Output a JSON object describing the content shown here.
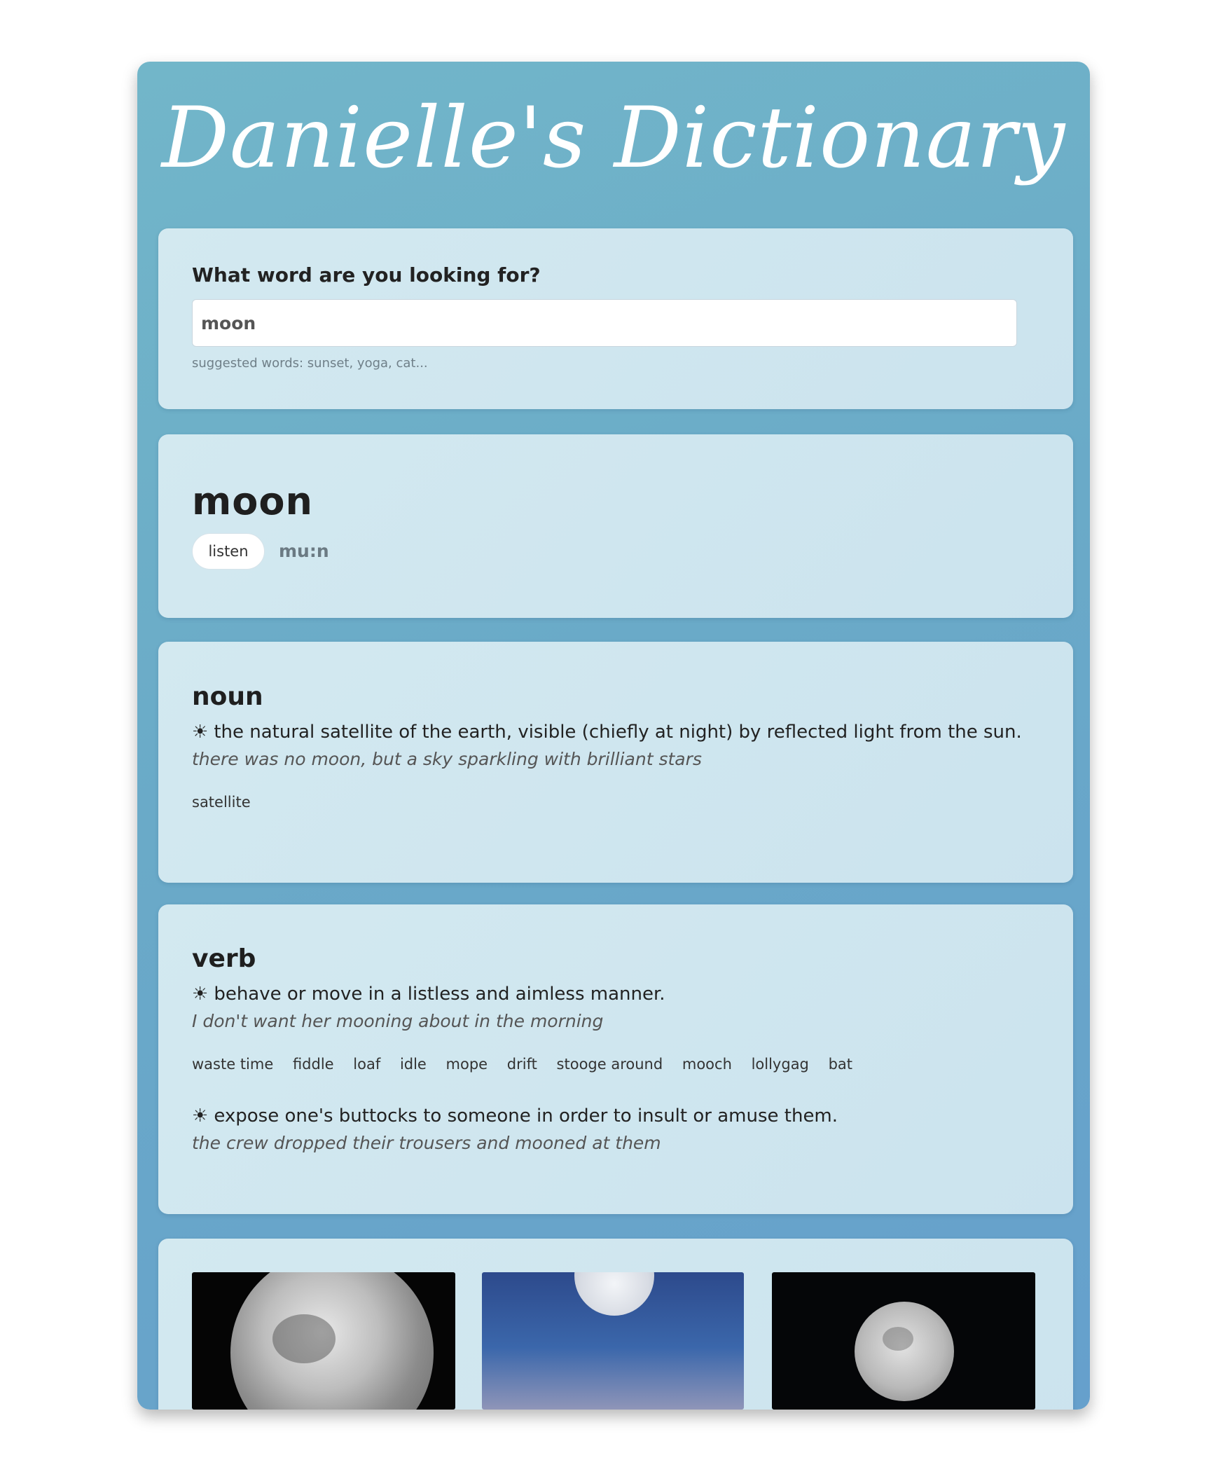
{
  "app": {
    "title": "Danielle's Dictionary"
  },
  "search": {
    "question": "What word are you looking for?",
    "value": "moon",
    "suggested": "suggested words: sunset, yoga, cat..."
  },
  "word": {
    "text": "moon",
    "listen_label": "listen",
    "phonetic": "mu:n"
  },
  "meanings": [
    {
      "part_of_speech": "noun",
      "definitions": [
        {
          "bullet": "☀",
          "definition": "the natural satellite of the earth, visible (chiefly at night) by reflected light from the sun.",
          "example": "there was no moon, but a sky sparkling with brilliant stars",
          "synonyms": [
            "satellite"
          ]
        }
      ]
    },
    {
      "part_of_speech": "verb",
      "definitions": [
        {
          "bullet": "☀",
          "definition": "behave or move in a listless and aimless manner.",
          "example": "I don't want her mooning about in the morning",
          "synonyms": [
            "waste time",
            "fiddle",
            "loaf",
            "idle",
            "mope",
            "drift",
            "stooge around",
            "mooch",
            "lollygag",
            "bat"
          ]
        },
        {
          "bullet": "☀",
          "definition": "expose one's buttocks to someone in order to insult or amuse them.",
          "example": "the crew dropped their trousers and mooned at them"
        }
      ]
    }
  ],
  "photos": [
    "moon-photo-closeup",
    "moon-photo-blue-sky",
    "moon-photo-night"
  ]
}
